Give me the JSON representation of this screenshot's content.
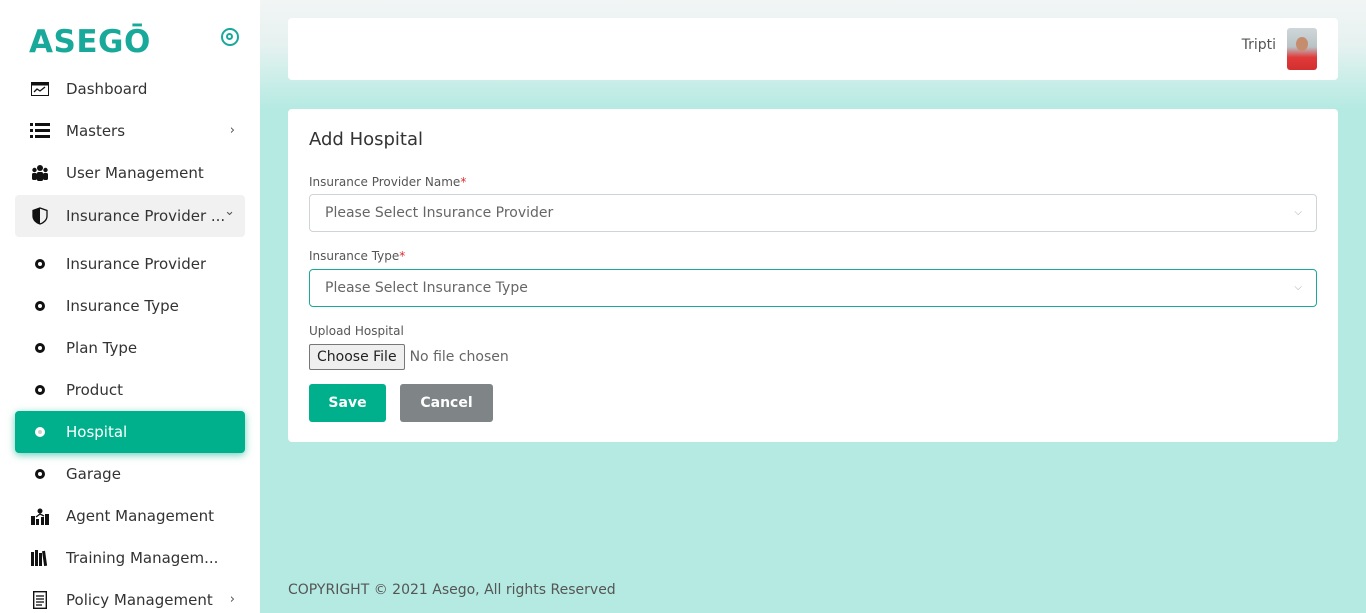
{
  "brand": {
    "logo_text": "ASEGŌ"
  },
  "sidebar": {
    "items": [
      {
        "label": "Dashboard",
        "icon": "dashboard-icon"
      },
      {
        "label": "Masters",
        "icon": "list-icon",
        "chevron": "›"
      },
      {
        "label": "User Management",
        "icon": "users-icon"
      },
      {
        "label": "Insurance Provider ...",
        "icon": "shield-icon",
        "chevron": "⌄"
      },
      {
        "label": "Insurance Provider",
        "icon": "dot-icon"
      },
      {
        "label": "Insurance Type",
        "icon": "dot-icon"
      },
      {
        "label": "Plan Type",
        "icon": "dot-icon"
      },
      {
        "label": "Product",
        "icon": "dot-icon"
      },
      {
        "label": "Hospital",
        "icon": "dot-icon"
      },
      {
        "label": "Garage",
        "icon": "dot-icon"
      },
      {
        "label": "Agent Management",
        "icon": "agent-icon"
      },
      {
        "label": "Training Managem...",
        "icon": "books-icon"
      },
      {
        "label": "Policy Management",
        "icon": "document-icon",
        "chevron": "›"
      }
    ]
  },
  "header": {
    "user_name": "Tripti"
  },
  "form": {
    "title": "Add Hospital",
    "provider_label": "Insurance Provider Name",
    "provider_placeholder": "Please Select Insurance Provider",
    "type_label": "Insurance Type",
    "type_placeholder": "Please Select Insurance Type",
    "required_mark": "*",
    "upload_label": "Upload Hospital",
    "choose_file": "Choose File",
    "no_file": "No file chosen",
    "save": "Save",
    "cancel": "Cancel"
  },
  "footer": {
    "copyright": "COPYRIGHT © 2021 Asego, All rights Reserved"
  },
  "colors": {
    "accent": "#00b08c",
    "brand": "#19a99a",
    "cancel": "#7f8487",
    "background": "#b4eae2"
  }
}
